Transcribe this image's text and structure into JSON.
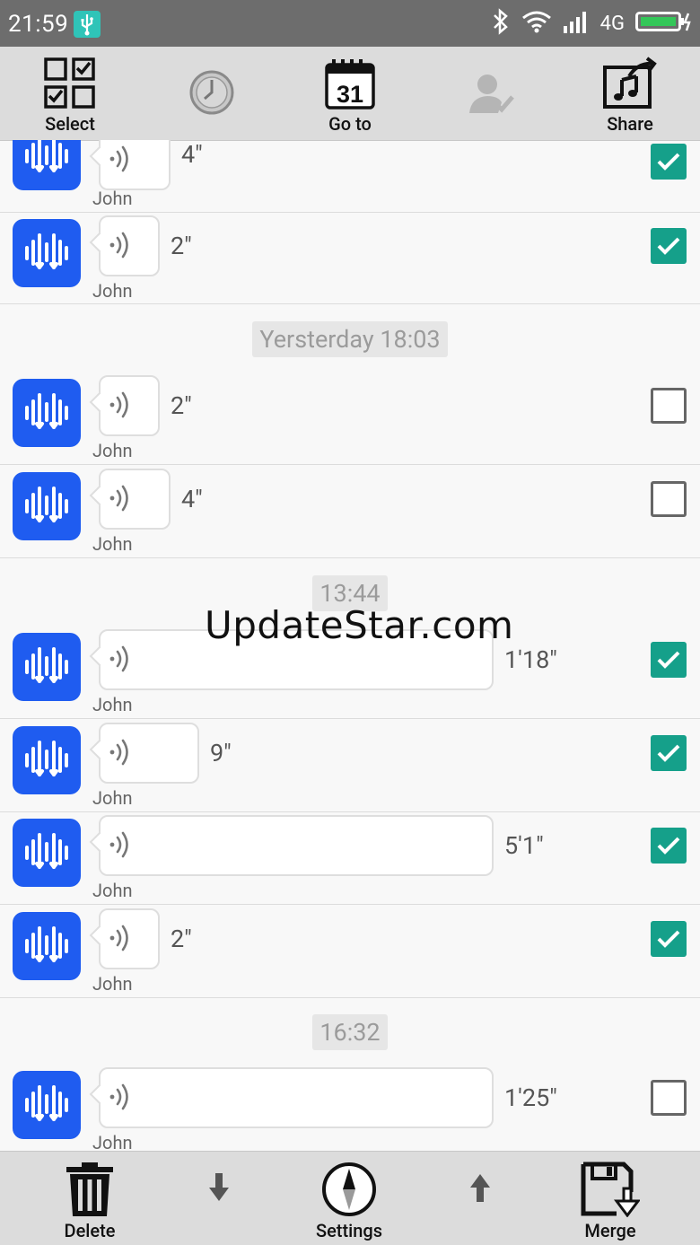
{
  "status_bar": {
    "time": "21:59",
    "network": "4G"
  },
  "toolbar": {
    "select": "Select",
    "goto": "Go to",
    "calendar_day": "31",
    "share": "Share"
  },
  "list": {
    "rows": [
      {
        "duration": "4\"",
        "sender": "John",
        "checked": true
      },
      {
        "duration": "2\"",
        "sender": "John",
        "checked": true
      },
      {
        "duration": "2\"",
        "sender": "John",
        "checked": false
      },
      {
        "duration": "4\"",
        "sender": "John",
        "checked": false
      },
      {
        "duration": "1'18\"",
        "sender": "John",
        "checked": true
      },
      {
        "duration": "9\"",
        "sender": "John",
        "checked": true
      },
      {
        "duration": "5'1\"",
        "sender": "John",
        "checked": true
      },
      {
        "duration": "2\"",
        "sender": "John",
        "checked": true
      },
      {
        "duration": "1'25\"",
        "sender": "John",
        "checked": false
      }
    ],
    "dividers": [
      "Yersterday 18:03",
      "13:44",
      "16:32"
    ]
  },
  "watermark": "UpdateStar.com",
  "bottom_bar": {
    "delete": "Delete",
    "settings": "Settings",
    "merge": "Merge"
  },
  "colors": {
    "avatar": "#1f5cf0",
    "checkbox_checked": "#15a08a",
    "toolbar_bg": "#dcdcdc"
  }
}
